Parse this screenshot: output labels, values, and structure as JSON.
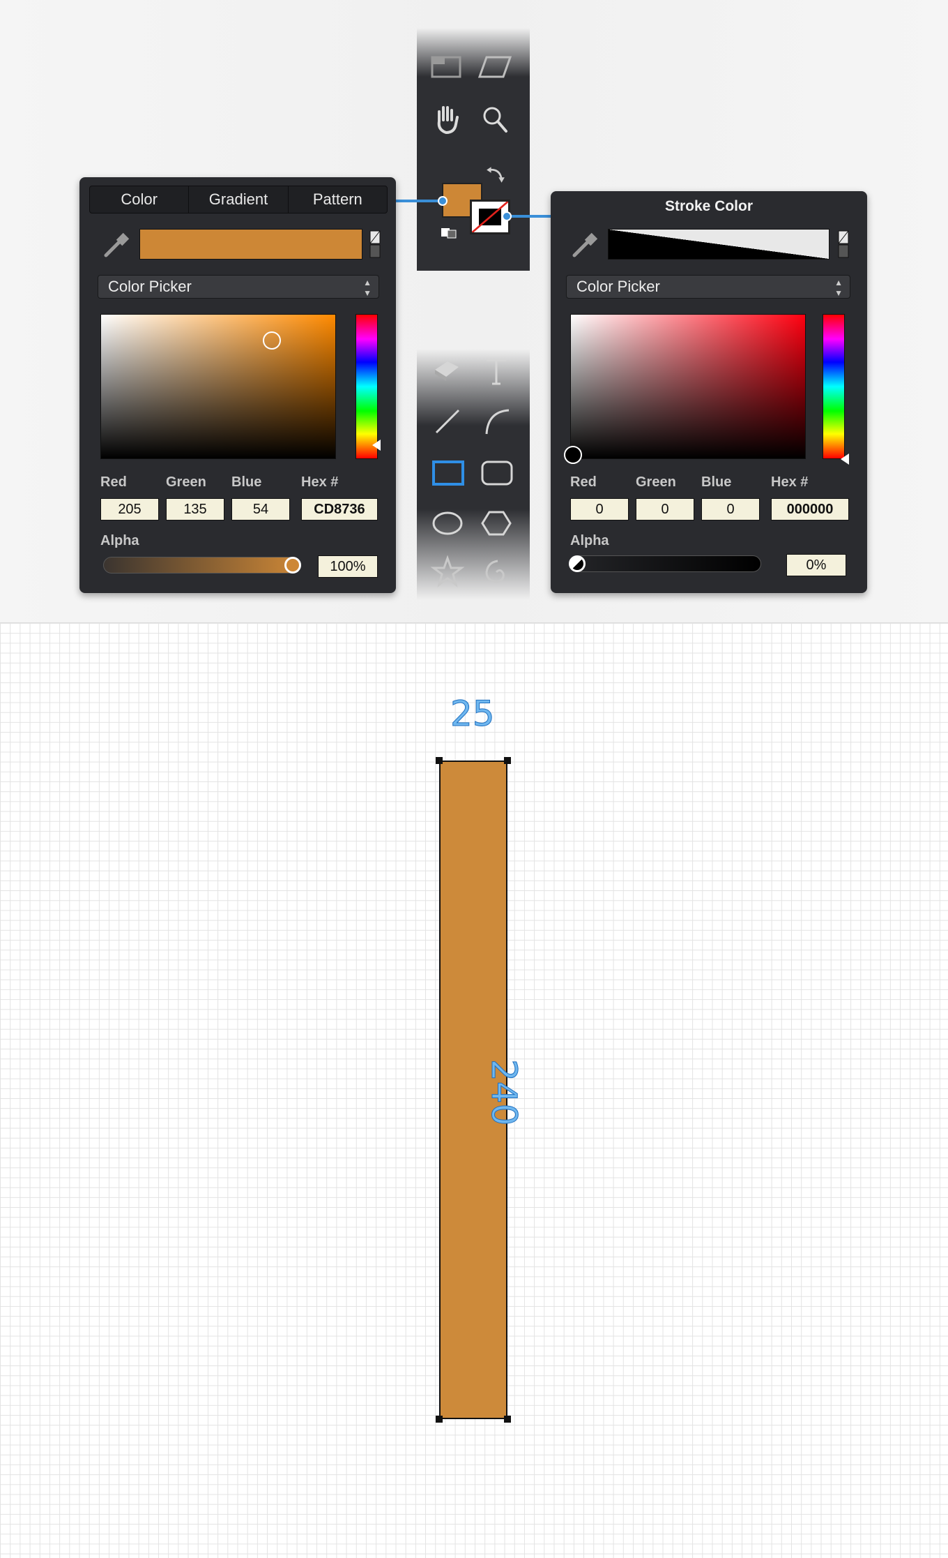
{
  "fill_panel": {
    "tabs": [
      "Color",
      "Gradient",
      "Pattern"
    ],
    "swatch_color": "#cd8736",
    "picker_mode": "Color Picker",
    "labels": {
      "red": "Red",
      "green": "Green",
      "blue": "Blue",
      "hex": "Hex #",
      "alpha": "Alpha"
    },
    "values": {
      "red": "205",
      "green": "135",
      "blue": "54",
      "hex": "CD8736",
      "alpha": "100%"
    }
  },
  "stroke_panel": {
    "title": "Stroke Color",
    "picker_mode": "Color Picker",
    "labels": {
      "red": "Red",
      "green": "Green",
      "blue": "Blue",
      "hex": "Hex #",
      "alpha": "Alpha"
    },
    "values": {
      "red": "0",
      "green": "0",
      "blue": "0",
      "hex": "000000",
      "alpha": "0%"
    }
  },
  "toolbar": {
    "upper_tools": [
      "artboard-tool-icon",
      "skew-tool-icon",
      "hand-tool-icon",
      "zoom-tool-icon",
      "swap-colors-icon",
      "default-colors-icon"
    ],
    "lower_tools": [
      "eraser-tool-icon",
      "text-tool-icon",
      "line-tool-icon",
      "curve-tool-icon",
      "rectangle-tool-icon",
      "rounded-rectangle-tool-icon",
      "ellipse-tool-icon",
      "polygon-tool-icon",
      "star-tool-icon",
      "spiral-tool-icon"
    ],
    "fill_color": "#cd8736",
    "stroke_color": "#000000"
  },
  "canvas": {
    "shape_fill": "#cd8a3a",
    "width_label": "25",
    "height_label": "240"
  }
}
